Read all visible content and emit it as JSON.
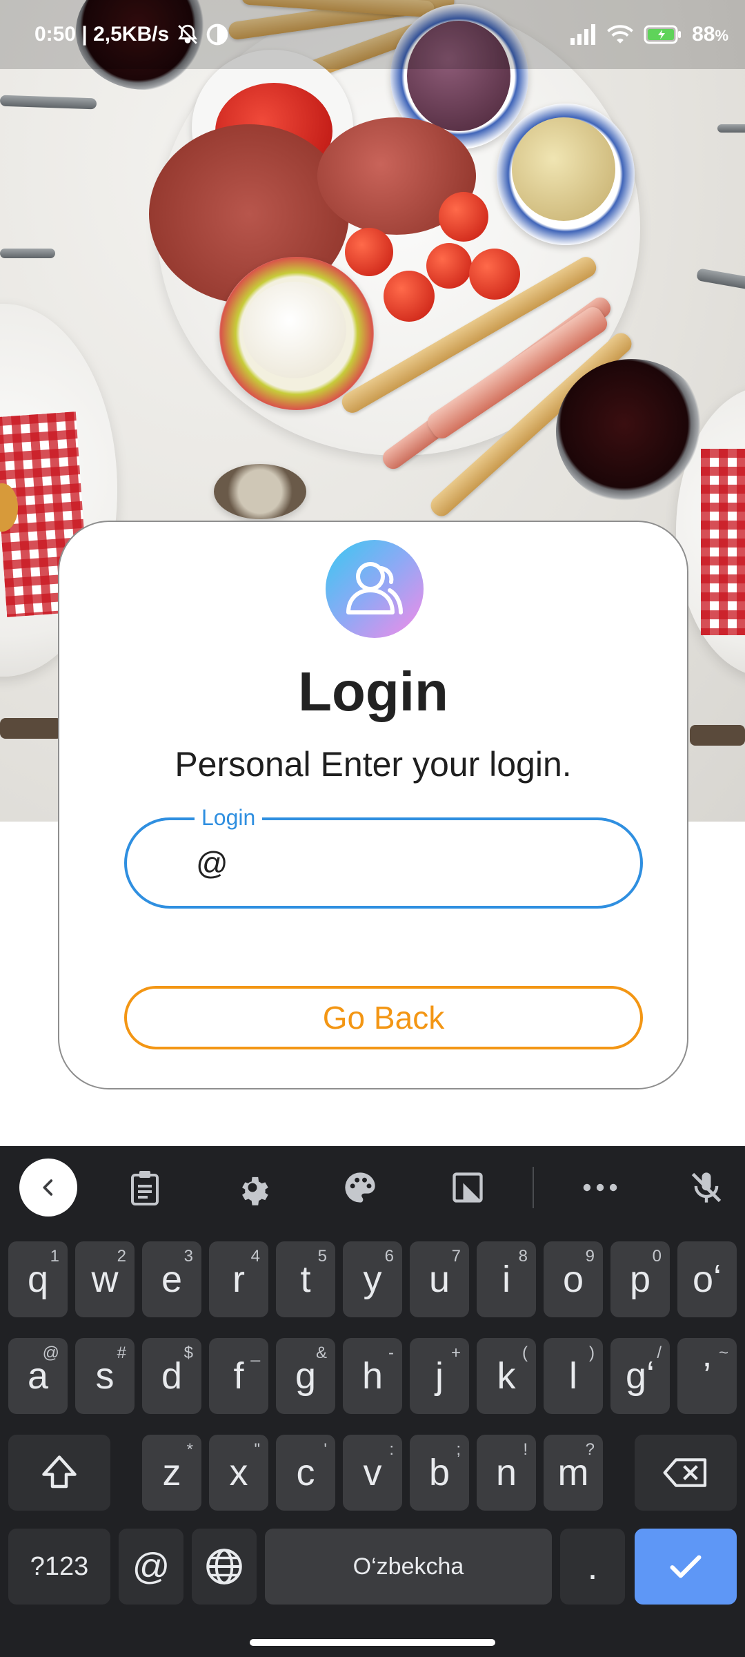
{
  "status_bar": {
    "time_and_speed": "0:50 | 2,5KB/s",
    "battery": "88",
    "battery_unit": "%"
  },
  "login_card": {
    "title": "Login",
    "subtitle": "Personal Enter your login.",
    "field": {
      "label": "Login",
      "value": "@"
    },
    "go_back_label": "Go Back"
  },
  "keyboard": {
    "row1": [
      {
        "key": "q",
        "hint": "1"
      },
      {
        "key": "w",
        "hint": "2"
      },
      {
        "key": "e",
        "hint": "3"
      },
      {
        "key": "r",
        "hint": "4"
      },
      {
        "key": "t",
        "hint": "5"
      },
      {
        "key": "y",
        "hint": "6"
      },
      {
        "key": "u",
        "hint": "7"
      },
      {
        "key": "i",
        "hint": "8"
      },
      {
        "key": "o",
        "hint": "9"
      },
      {
        "key": "p",
        "hint": "0"
      },
      {
        "key": "oʻ",
        "hint": ""
      }
    ],
    "row2": [
      {
        "key": "a",
        "hint": "@"
      },
      {
        "key": "s",
        "hint": "#"
      },
      {
        "key": "d",
        "hint": "$"
      },
      {
        "key": "f",
        "hint": "_"
      },
      {
        "key": "g",
        "hint": "&"
      },
      {
        "key": "h",
        "hint": "-"
      },
      {
        "key": "j",
        "hint": "+"
      },
      {
        "key": "k",
        "hint": "("
      },
      {
        "key": "l",
        "hint": ")"
      },
      {
        "key": "gʻ",
        "hint": "/"
      },
      {
        "key": "’",
        "hint": "~"
      }
    ],
    "row3": [
      {
        "key": "z",
        "hint": "*"
      },
      {
        "key": "x",
        "hint": "\""
      },
      {
        "key": "c",
        "hint": "'"
      },
      {
        "key": "v",
        "hint": ":"
      },
      {
        "key": "b",
        "hint": ";"
      },
      {
        "key": "n",
        "hint": "!"
      },
      {
        "key": "m",
        "hint": "?"
      }
    ],
    "symbols_label": "?123",
    "at_label": "@",
    "space_label": "O‘zbekcha",
    "period_label": "."
  },
  "colors": {
    "field_accent": "#2f8fe0",
    "go_back_accent": "#f39614",
    "keyboard_bg": "#202124",
    "enter_key": "#5e97f6"
  }
}
